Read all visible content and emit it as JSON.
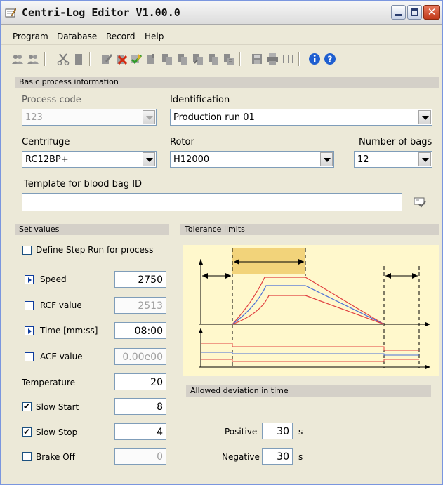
{
  "window": {
    "title": "Centri-Log Editor V1.00.0"
  },
  "menu": {
    "program": "Program",
    "database": "Database",
    "record": "Record",
    "help": "Help"
  },
  "toolbar": {
    "icons": [
      "users-icon",
      "users-disabled-icon",
      "cut-icon",
      "clipboard-icon",
      "edit-icon",
      "delete-icon",
      "validate-icon",
      "edit-doc-icon",
      "copy-doc-icon",
      "doc-copy2-icon",
      "doc-arrow-icon",
      "doc-stack-icon",
      "doc-grid-icon",
      "save-icon",
      "print-icon",
      "barcode-icon",
      "info-icon",
      "help-icon"
    ]
  },
  "basic": {
    "header": "Basic process information",
    "process_code_label": "Process code",
    "process_code": "123",
    "identification_label": "Identification",
    "identification": "Production run 01",
    "centrifuge_label": "Centrifuge",
    "centrifuge": "RC12BP+",
    "rotor_label": "Rotor",
    "rotor": "H12000",
    "bags_label": "Number of bags",
    "bags": "12",
    "template_label": "Template for blood bag ID",
    "template": ""
  },
  "setvalues": {
    "header": "Set values",
    "define_step": "Define Step Run for process",
    "define_step_checked": false,
    "speed_label": "Speed",
    "speed": "2750",
    "rcf_label": "RCF value",
    "rcf": "2513",
    "time_label": "Time [mm:ss]",
    "time": "08:00",
    "ace_label": "ACE value",
    "ace": "0.00e00",
    "temperature_label": "Temperature",
    "temperature": "20",
    "slow_start_label": "Slow Start",
    "slow_start_checked": true,
    "slow_start": "8",
    "slow_stop_label": "Slow Stop",
    "slow_stop_checked": true,
    "slow_stop": "4",
    "brake_off_label": "Brake Off",
    "brake_off_checked": false,
    "brake_off": "0"
  },
  "tolerance": {
    "header": "Tolerance limits",
    "deviation_header": "Allowed deviation in time",
    "positive_label": "Positive",
    "positive": "30",
    "positive_unit": "s",
    "negative_label": "Negative",
    "negative": "30",
    "negative_unit": "s"
  },
  "colors": {
    "diagram_bg": "#fff8cc",
    "highlight": "#f2d37a",
    "upper": "#e04040",
    "nominal": "#4a6fd8",
    "section": "#d4d0c8"
  }
}
